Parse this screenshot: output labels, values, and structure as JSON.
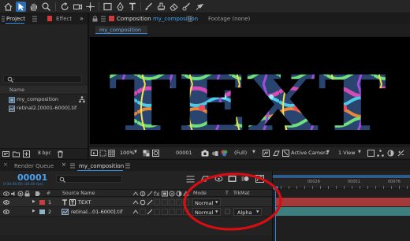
{
  "project_panel": {
    "tab_project": "Project",
    "tab_effect": "Effect",
    "column_name": "Name",
    "items": [
      {
        "label": "my_composition"
      },
      {
        "label": "retinal2.[0001-6000].tif"
      }
    ],
    "bpc": "8 bpc"
  },
  "composition_panel": {
    "tab_prefix": "Composition",
    "tab_name": "my_composition",
    "footage_tab": "Footage (none)",
    "sub_tab": "my_composition",
    "canvas_text": "TEXT",
    "zoom": "100%",
    "timecode": "00001",
    "resolution": "(Full)",
    "camera": "Active Camera",
    "views": "1 View"
  },
  "timeline_panel": {
    "tab_render_queue": "Render Queue",
    "tab_comp": "my_composition",
    "timecode": "00001",
    "timecode_sub": "0:00:00:00 (30.00 fps)",
    "col_source_name": "Source Name",
    "col_mode": "Mode",
    "col_t": "T",
    "col_trkmat": "TrkMat",
    "ruler_labels": [
      "00026",
      "00051",
      "00076"
    ],
    "layers": [
      {
        "index": "1",
        "name": "TEXT",
        "color": "#cc3a3a",
        "mode": "Normal",
        "trkmat": ""
      },
      {
        "index": "2",
        "name": "retinal...01-6000].tif",
        "color": "#8fb3c9",
        "mode": "Normal",
        "trkmat": "Alpha"
      }
    ]
  },
  "colors": {
    "accent_blue": "#2d8ceb",
    "annotation_red": "#d60e12",
    "track_red": "#a63a3a",
    "track_teal": "#3d7f7f"
  }
}
